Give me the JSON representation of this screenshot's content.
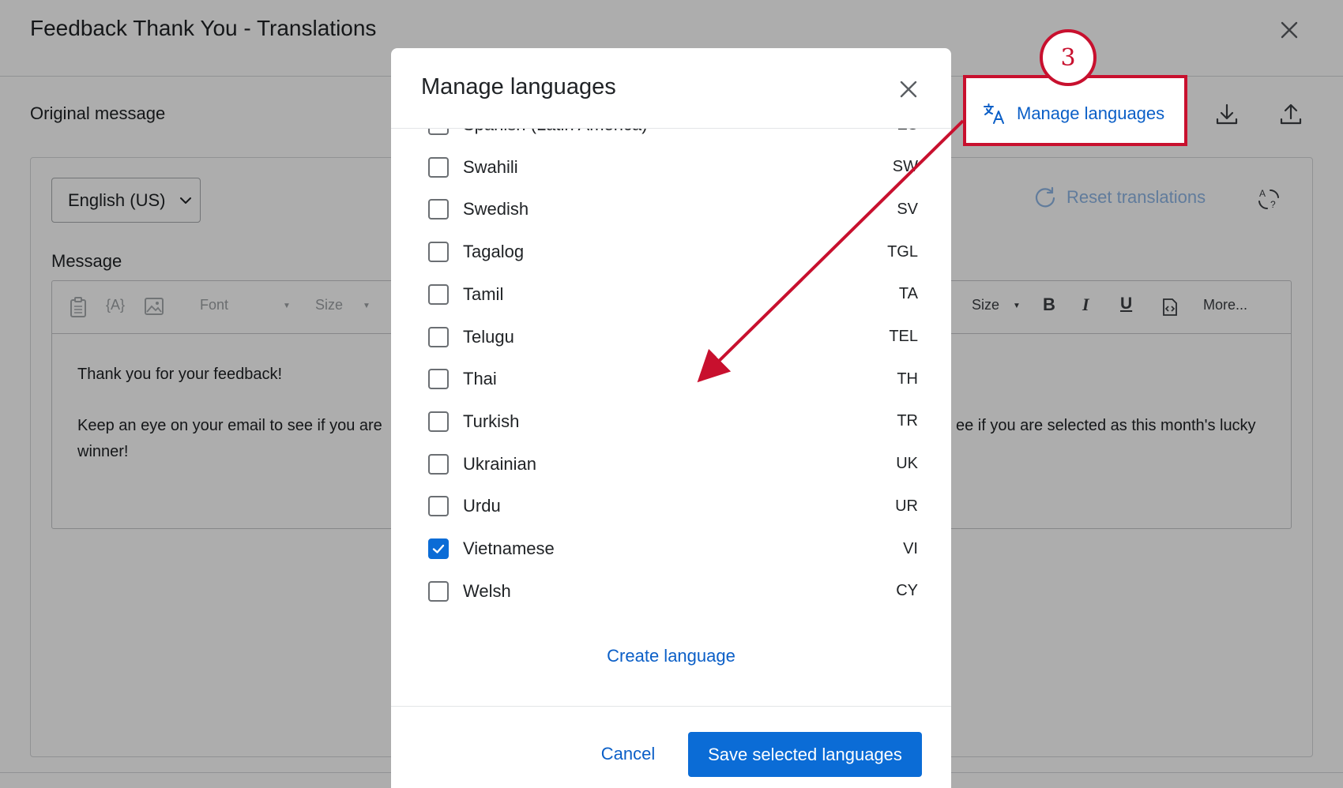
{
  "page": {
    "title": "Feedback Thank You - Translations",
    "original_message_label": "Original message",
    "manage_languages_label": "Manage languages",
    "language_select_value": "English (US)",
    "reset_translations_label": "Reset translations",
    "message_label": "Message",
    "toolbar": {
      "font_label": "Font",
      "size_label": "Size",
      "size_label_right": "Size",
      "bold": "B",
      "italic": "I",
      "underline": "U",
      "more_label": "More..."
    },
    "message_paragraph_1": "Thank you for your feedback!",
    "message_paragraph_2_left": "Keep an eye on your email to see if you are",
    "message_paragraph_2_right": "ee if you are selected as this month's lucky",
    "message_paragraph_2_end": "winner!"
  },
  "modal": {
    "title": "Manage languages",
    "languages": [
      {
        "name": "Spanish (Latin America)",
        "code": "ES",
        "checked": false
      },
      {
        "name": "Swahili",
        "code": "SW",
        "checked": false
      },
      {
        "name": "Swedish",
        "code": "SV",
        "checked": false
      },
      {
        "name": "Tagalog",
        "code": "TGL",
        "checked": false
      },
      {
        "name": "Tamil",
        "code": "TA",
        "checked": false
      },
      {
        "name": "Telugu",
        "code": "TEL",
        "checked": false
      },
      {
        "name": "Thai",
        "code": "TH",
        "checked": false
      },
      {
        "name": "Turkish",
        "code": "TR",
        "checked": false
      },
      {
        "name": "Ukrainian",
        "code": "UK",
        "checked": false
      },
      {
        "name": "Urdu",
        "code": "UR",
        "checked": false
      },
      {
        "name": "Vietnamese",
        "code": "VI",
        "checked": true
      },
      {
        "name": "Welsh",
        "code": "CY",
        "checked": false
      }
    ],
    "create_language_label": "Create language",
    "cancel_label": "Cancel",
    "save_label": "Save selected languages"
  },
  "annotation": {
    "step_number": "3",
    "color": "#c8102e"
  },
  "colors": {
    "primary": "#0b6cd6",
    "link": "#0b5fc7"
  }
}
